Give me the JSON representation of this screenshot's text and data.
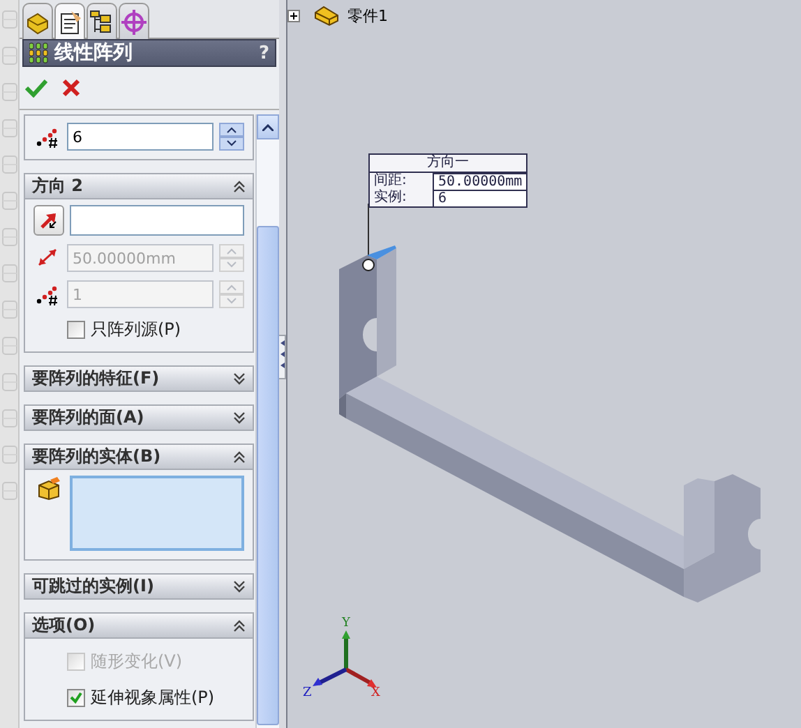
{
  "tabs": [
    {
      "kind": "feature",
      "selected": false
    },
    {
      "kind": "property",
      "selected": true
    },
    {
      "kind": "config",
      "selected": false
    },
    {
      "kind": "display",
      "selected": false
    }
  ],
  "panel": {
    "title": "线性阵列",
    "help": "?"
  },
  "sections": [
    {
      "kind": "count",
      "count": {
        "value": "6",
        "disabled": false
      }
    },
    {
      "kind": "direction",
      "title": "方向 2",
      "expanded": true,
      "distance": {
        "value": "50.00000mm",
        "disabled": true
      },
      "count": {
        "value": "1",
        "disabled": true
      },
      "options": [
        {
          "label": "只阵列源(P)",
          "checked": false,
          "disabled": false
        }
      ]
    },
    {
      "kind": "list",
      "title": "要阵列的特征(F)",
      "expanded": false
    },
    {
      "kind": "list",
      "title": "要阵列的面(A)",
      "expanded": false
    },
    {
      "kind": "list",
      "title": "要阵列的实体(B)",
      "expanded": true
    },
    {
      "kind": "list",
      "title": "可跳过的实例(I)",
      "expanded": false
    },
    {
      "kind": "options",
      "title": "选项(O)",
      "expanded": true,
      "options": [
        {
          "label": "随形变化(V)",
          "checked": false,
          "disabled": true
        },
        {
          "label": "延伸视象属性(P)",
          "checked": true,
          "disabled": false
        }
      ]
    }
  ],
  "viewport": {
    "tree": {
      "label": "零件1",
      "expanded": false
    },
    "callout": {
      "title": "方向一",
      "rows": [
        {
          "label": "间距:",
          "value": "50.00000mm"
        },
        {
          "label": "实例:",
          "value": "6"
        }
      ]
    },
    "triad": {
      "x": "X",
      "y": "Y",
      "z": "Z"
    }
  }
}
